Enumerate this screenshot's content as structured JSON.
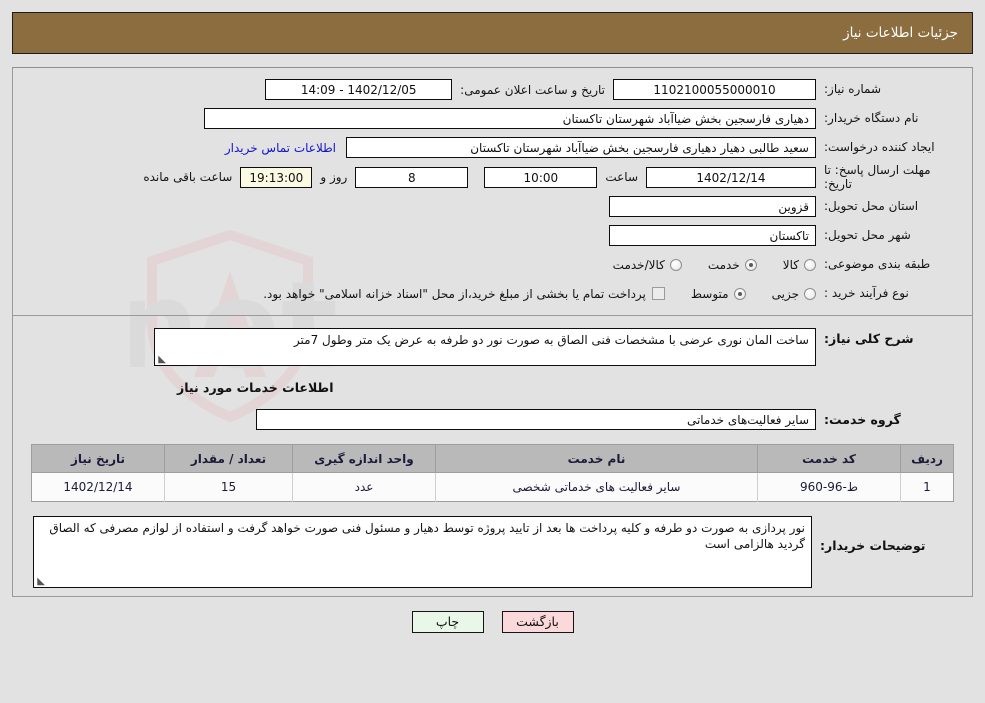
{
  "header": {
    "title": "جزئیات اطلاعات نیاز"
  },
  "top_section": {
    "need_number_label": "شماره نیاز:",
    "need_number_value": "1102100055000010",
    "announce_label": "تاریخ و ساعت اعلان عمومی:",
    "announce_value": "14:09 - 1402/12/05",
    "buyer_org_label": "نام دستگاه خریدار:",
    "buyer_org_value": "دهیاری فارسجین بخش ضیاآباد شهرستان تاکستان",
    "creator_label": "ایجاد کننده درخواست:",
    "creator_value": "سعید طالبی دهیار دهیاری فارسجین بخش ضیاآباد شهرستان تاکستان",
    "contact_link": "اطلاعات تماس خریدار",
    "deadline_label": "مهلت ارسال پاسخ: تا تاریخ:",
    "deadline_date": "1402/12/14",
    "hour_label": "ساعت",
    "deadline_time": "10:00",
    "days_value": "8",
    "days_label": "روز و",
    "remaining_time": "19:13:00",
    "remaining_label": "ساعت باقی مانده",
    "province_label": "استان محل تحویل:",
    "province_value": "قزوین",
    "city_label": "شهر محل تحویل:",
    "city_value": "تاکستان",
    "category_label": "طبقه بندی موضوعی:",
    "category_options": [
      {
        "label": "کالا",
        "checked": false
      },
      {
        "label": "خدمت",
        "checked": true
      },
      {
        "label": "کالا/خدمت",
        "checked": false
      }
    ],
    "purchase_type_label": "نوع فرآیند خرید :",
    "purchase_type_options": [
      {
        "label": "جزیی",
        "checked": false
      },
      {
        "label": "متوسط",
        "checked": true
      }
    ],
    "treasury_checkbox_label": "پرداخت تمام یا بخشی از مبلغ خرید،از محل \"اسناد خزانه اسلامی\" خواهد بود.",
    "treasury_checked": false
  },
  "mid_section": {
    "general_desc_label": "شرح کلی نیاز:",
    "general_desc_value": "ساخت المان نوری عرضی با مشخصات فنی الصاق به صورت نور دو طرفه به عرض یک متر وطول 7متر",
    "services_heading": "اطلاعات خدمات مورد نیاز",
    "service_group_label": "گروه خدمت:",
    "service_group_value": "سایر فعالیت‌های خدماتی"
  },
  "table": {
    "columns": [
      "ردیف",
      "کد خدمت",
      "نام خدمت",
      "واحد اندازه گیری",
      "تعداد / مقدار",
      "تاریخ نیاز"
    ],
    "rows": [
      {
        "row_no": "1",
        "service_code": "ط-96-960",
        "service_name": "سایر فعالیت های خدماتی شخصی",
        "unit": "عدد",
        "quantity": "15",
        "need_date": "1402/12/14"
      }
    ]
  },
  "notes": {
    "label": "توضیحات خریدار:",
    "value": "نور پردازی به صورت دو طرفه و کلیه پرداخت ها بعد از تایید پروژه توسط دهیار و مسئول فنی صورت خواهد گرفت و استفاده از لوازم مصرفی که الصاق گردید هالزامی است"
  },
  "footer": {
    "print_label": "چاپ",
    "back_label": "بازگشت"
  },
  "watermark": {
    "text": "AriaTender.net"
  },
  "colors": {
    "header_bg": "#8c6d3f",
    "page_bg": "#e2e2e2",
    "link": "#1414cc",
    "table_header_bg": "#b9b9b9",
    "print_btn_bg": "#e9f7e9",
    "back_btn_bg": "#fbd9da",
    "countdown_bg": "#fbfbe4"
  }
}
